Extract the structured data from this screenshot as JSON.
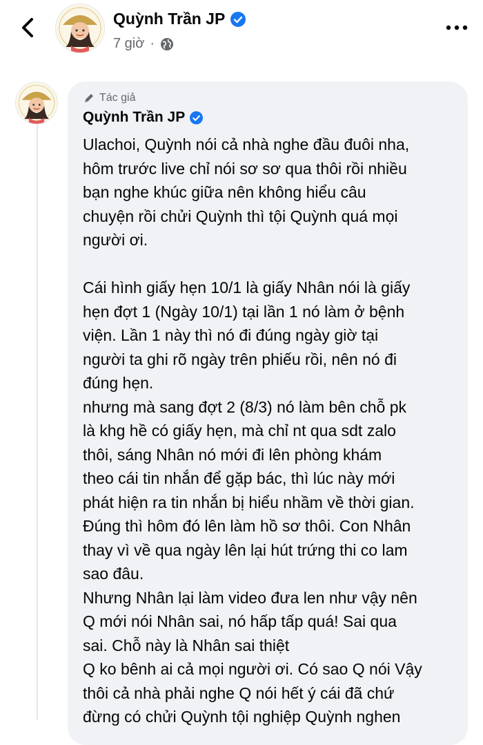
{
  "header": {
    "back_icon": "chevron-left-icon",
    "author_name": "Quỳnh Trần JP",
    "time": "7 giờ",
    "separator": "·",
    "privacy_icon": "globe-icon",
    "more_icon": "more-icon"
  },
  "comment": {
    "author_badge": "Tác giả",
    "author_name": "Quỳnh Trần JP",
    "lines": [
      "Ulachoi, Quỳnh nói cả nhà nghe đầu đuôi nha,",
      "hôm trước live chỉ nói sơ sơ qua thôi rồi nhiều",
      "bạn nghe khúc giữa nên không hiểu câu",
      "chuyện rồi chửi Quỳnh thì tội Quỳnh quá mọi",
      "người ơi.",
      "",
      "Cái hình giấy hẹn 10/1 là giấy Nhân nói là giấy",
      "hẹn đợt 1 (Ngày 10/1) tại lần 1 nó làm ở bệnh",
      "viện. Lần 1 này thì nó đi đúng ngày giờ tại",
      "người ta ghi rõ ngày trên phiếu rồi, nên nó đi",
      "đúng hẹn.",
      "nhưng mà sang đợt 2 (8/3) nó làm bên chỗ pk",
      "là khg hề có giấy hẹn, mà chỉ nt qua sdt zalo",
      "thôi, sáng Nhân nó mới đi lên phòng khám",
      "theo cái tin nhắn để gặp bác, thì lúc này mới",
      "phát hiện ra tin nhắn bị hiểu nhầm về thời gian.",
      "Đúng thì hôm đó lên làm hồ sơ thôi. Con Nhân",
      "thay vì về qua ngày lên lại hút trứng thi co lam",
      "sao đâu.",
      "Nhưng Nhân lại làm video đưa len như vậy nên",
      "Q mới nói Nhân sai, nó hấp tấp quá! Sai qua",
      "sai. Chỗ này là Nhân sai thiệt",
      "Q ko bênh ai cả mọi người ơi. Có sao Q nói Vậy",
      "thôi cả nhà phải nghe Q nói hết ý cái đã chứ",
      "đừng có chửi Quỳnh tội nghiệp Quỳnh nghen"
    ]
  },
  "colors": {
    "verified": "#1877f2",
    "muted_text": "#65676b",
    "bubble_bg": "#f0f2f5"
  }
}
